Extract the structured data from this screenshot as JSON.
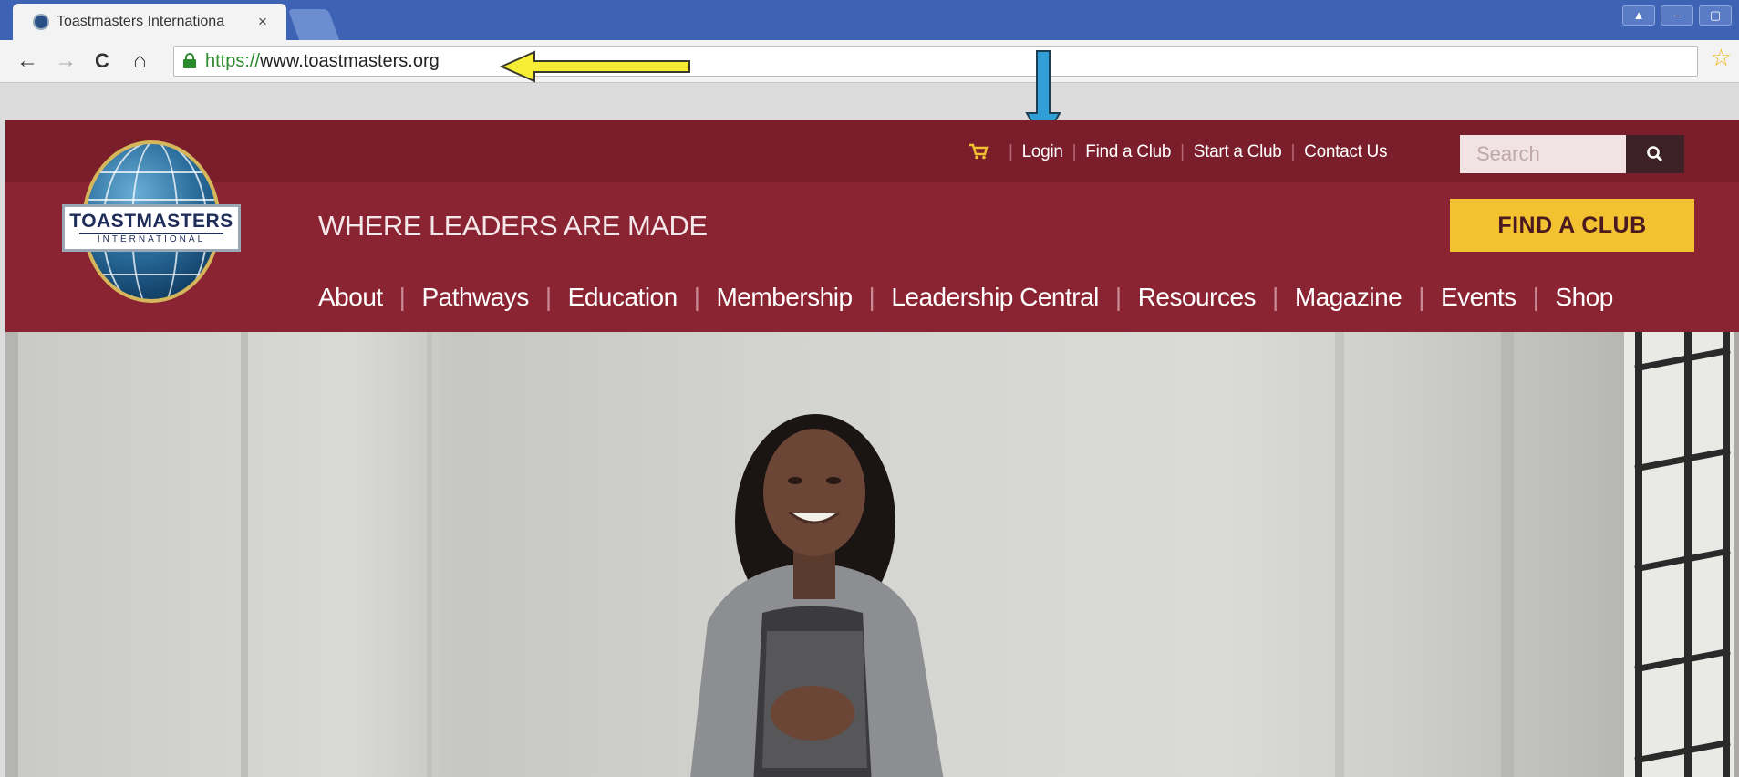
{
  "browser": {
    "tab_title": "Toastmasters Internationa",
    "tab_close": "×",
    "url_scheme": "https://",
    "url_host": "www.toastmasters.org",
    "window_buttons": [
      "▲",
      "–",
      "▢"
    ],
    "nav": {
      "back": "←",
      "forward": "→",
      "reload": "C",
      "home": "⌂"
    },
    "star": "☆"
  },
  "site": {
    "logo": {
      "word1": "TOASTMASTERS",
      "word2": "INTERNATIONAL"
    },
    "util_links": [
      "Login",
      "Find a Club",
      "Start a Club",
      "Contact Us"
    ],
    "search_placeholder": "Search",
    "tagline": "WHERE LEADERS ARE MADE",
    "find_club_button": "FIND A CLUB",
    "main_nav": [
      "About",
      "Pathways",
      "Education",
      "Membership",
      "Leadership Central",
      "Resources",
      "Magazine",
      "Events",
      "Shop"
    ],
    "separator": "|"
  },
  "annotations": {
    "yellow_arrow_color": "#f5ee35",
    "blue_arrow_color": "#2f9fd6"
  },
  "colors": {
    "util_bar": "#7b1e2c",
    "main_band": "#8a2432",
    "find_club_button": "#f2c230",
    "chrome_tabstrip": "#3f63b4"
  }
}
